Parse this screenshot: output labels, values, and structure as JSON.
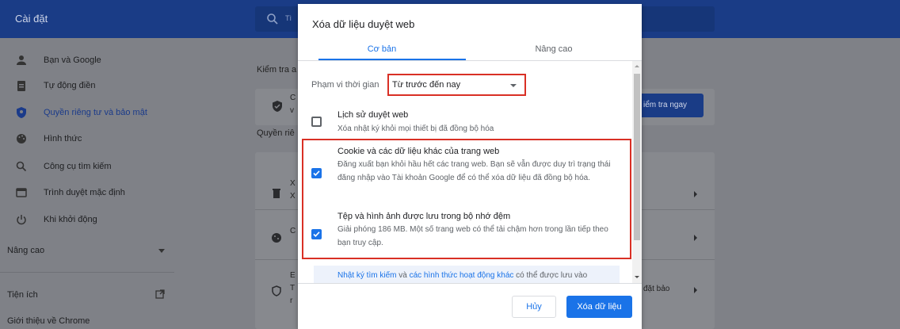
{
  "header": {
    "title": "Cài đặt",
    "search_placeholder": "Tì"
  },
  "sidebar": {
    "items": [
      {
        "label": "Bạn và Google",
        "icon": "person-icon"
      },
      {
        "label": "Tự động điền",
        "icon": "clipboard-icon"
      },
      {
        "label": "Quyền riêng tư và bảo mật",
        "icon": "shield-icon"
      },
      {
        "label": "Hình thức",
        "icon": "palette-icon"
      },
      {
        "label": "Công cụ tìm kiếm",
        "icon": "search-icon"
      },
      {
        "label": "Trình duyệt mặc định",
        "icon": "browser-icon"
      },
      {
        "label": "Khi khởi động",
        "icon": "power-icon"
      }
    ],
    "advanced": "Nâng cao",
    "extensions": "Tiện ích",
    "about": "Giới thiệu về Chrome"
  },
  "background": {
    "safety_check": "Kiểm tra a",
    "safety_check_button": "iểm tra ngay",
    "privacy_title": "Quyền riê",
    "security_tail": "đặt bảo",
    "row_letters": [
      "C",
      "v",
      "X",
      "X",
      "C",
      "E",
      "T",
      "r"
    ]
  },
  "dialog": {
    "title": "Xóa dữ liệu duyệt web",
    "tabs": {
      "basic": "Cơ bản",
      "advanced": "Nâng cao"
    },
    "time_range_label": "Phạm vi thời gian",
    "time_range_value": "Từ trước đến nay",
    "options": [
      {
        "title": "Lịch sử duyệt web",
        "desc": "Xóa nhật ký khỏi mọi thiết bị đã đồng bộ hóa",
        "checked": false
      },
      {
        "title": "Cookie và các dữ liệu khác của trang web",
        "desc": "Đăng xuất bạn khỏi hầu hết các trang web. Bạn sẽ vẫn được duy trì trạng thái đăng nhập vào Tài khoản Google để có thể xóa dữ liệu đã đồng bộ hóa.",
        "checked": true
      },
      {
        "title": "Tệp và hình ảnh được lưu trong bộ nhớ đệm",
        "desc": "Giải phóng 186 MB. Một số trang web có thể tải chậm hơn trong lần tiếp theo bạn truy cập.",
        "checked": true
      }
    ],
    "info_link1": "Nhật ký tìm kiếm",
    "info_mid": " và ",
    "info_link2": "các hình thức hoạt động khác",
    "info_tail": " có thể được lưu vào",
    "cancel": "Hủy",
    "clear": "Xóa dữ liệu"
  },
  "colors": {
    "accent": "#1a73e8",
    "highlight": "#d93025",
    "header": "#1a3c86"
  }
}
